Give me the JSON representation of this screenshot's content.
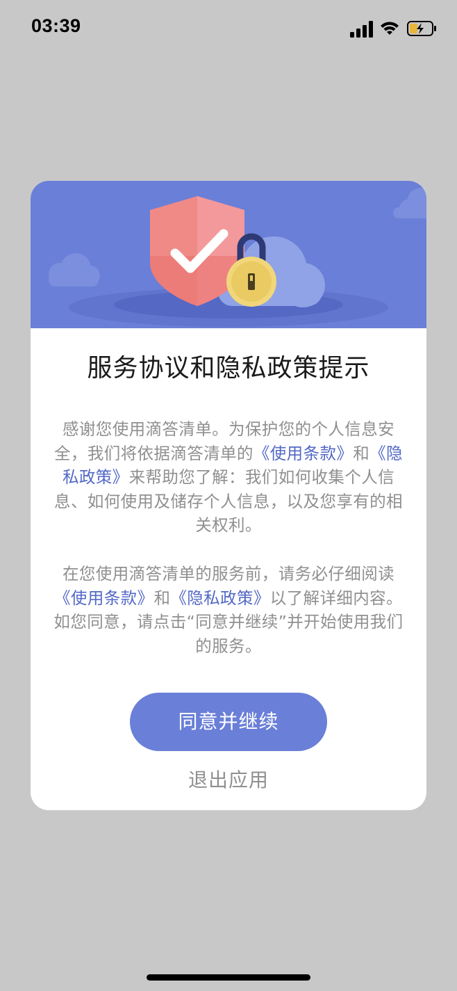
{
  "status_bar": {
    "time": "03:39",
    "icons": [
      "signal-icon",
      "wifi-icon",
      "battery-charging-icon"
    ]
  },
  "dialog": {
    "illustration": [
      "shield-check-icon",
      "padlock-icon",
      "cloud-icon"
    ],
    "title": "服务协议和隐私政策提示",
    "paragraph1": {
      "text_a": "感谢您使用滴答清单。为保护您的个人信息安全，我们将依据滴答清单的",
      "link_terms": "《使用条款》",
      "text_b": "和",
      "link_privacy": "《隐私政策》",
      "text_c": "来帮助您了解：我们如何收集个人信息、如何使用及储存个人信息，以及您享有的相关权利。"
    },
    "paragraph2": {
      "text_a": "在您使用滴答清单的服务前，请务必仔细阅读",
      "link_terms": "《使用条款》",
      "text_b": "和",
      "link_privacy": "《隐私政策》",
      "text_c": "以了解详细内容。如您同意，请点击“同意并继续”并开始使用我们的服务。"
    },
    "agree_button": "同意并继续",
    "exit_button": "退出应用"
  },
  "colors": {
    "accent": "#6a7fd7",
    "link": "#5368c6",
    "body_text": "#8f8f8f",
    "title_text": "#1a1a1a",
    "backdrop": "#c8c8c8"
  }
}
